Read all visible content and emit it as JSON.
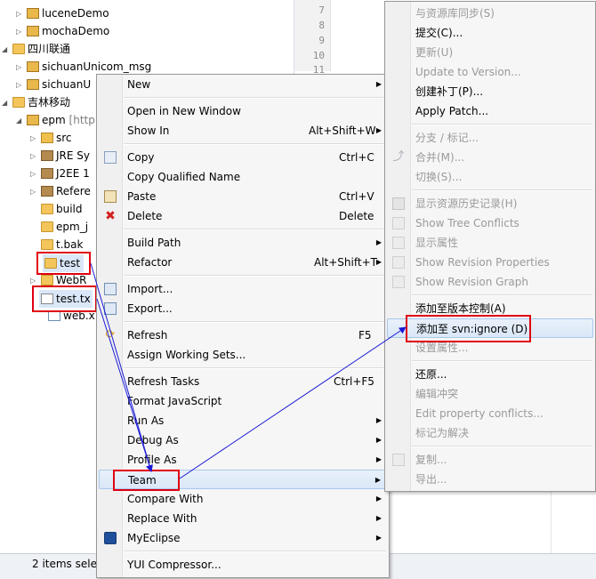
{
  "tree": {
    "rows": [
      {
        "label": "luceneDemo",
        "suffix": ""
      },
      {
        "label": "mochaDemo",
        "suffix": ""
      },
      {
        "label": "四川联通",
        "suffix": ""
      },
      {
        "label": "sichuanUnicom_msg",
        "suffix": ""
      },
      {
        "label": "sichuanU",
        "suffix": ""
      },
      {
        "label": "吉林移动",
        "suffix": ""
      },
      {
        "label": "epm",
        "suffix": "[http"
      },
      {
        "label": "src",
        "suffix": ""
      },
      {
        "label": "JRE Sy",
        "suffix": ""
      },
      {
        "label": "J2EE 1",
        "suffix": ""
      },
      {
        "label": "Refere",
        "suffix": ""
      },
      {
        "label": "build",
        "suffix": ""
      },
      {
        "label": "epm_j",
        "suffix": ""
      },
      {
        "label": "t.bak",
        "suffix": ""
      },
      {
        "label": "test",
        "suffix": ""
      },
      {
        "label": "WebR",
        "suffix": ""
      },
      {
        "label": "test.tx",
        "suffix": ""
      },
      {
        "label": "web.x",
        "suffix": ""
      }
    ]
  },
  "editor": {
    "line_numbers": [
      "7",
      "8",
      "9",
      "10",
      "11"
    ]
  },
  "status": {
    "text": "2 items sele"
  },
  "context_menu": {
    "items": [
      {
        "label": "New",
        "shortcut": "",
        "submenu": true
      },
      {
        "label": "Open in New Window",
        "shortcut": "",
        "submenu": false
      },
      {
        "label": "Show In",
        "shortcut": "Alt+Shift+W",
        "submenu": true
      },
      {
        "label": "Copy",
        "shortcut": "Ctrl+C",
        "submenu": false
      },
      {
        "label": "Copy Qualified Name",
        "shortcut": "",
        "submenu": false
      },
      {
        "label": "Paste",
        "shortcut": "Ctrl+V",
        "submenu": false
      },
      {
        "label": "Delete",
        "shortcut": "Delete",
        "submenu": false
      },
      {
        "label": "Build Path",
        "shortcut": "",
        "submenu": true
      },
      {
        "label": "Refactor",
        "shortcut": "Alt+Shift+T",
        "submenu": true
      },
      {
        "label": "Import...",
        "shortcut": "",
        "submenu": false
      },
      {
        "label": "Export...",
        "shortcut": "",
        "submenu": false
      },
      {
        "label": "Refresh",
        "shortcut": "F5",
        "submenu": false
      },
      {
        "label": "Assign Working Sets...",
        "shortcut": "",
        "submenu": false
      },
      {
        "label": "Refresh Tasks",
        "shortcut": "Ctrl+F5",
        "submenu": false
      },
      {
        "label": "Format JavaScript",
        "shortcut": "",
        "submenu": false
      },
      {
        "label": "Run As",
        "shortcut": "",
        "submenu": true
      },
      {
        "label": "Debug As",
        "shortcut": "",
        "submenu": true
      },
      {
        "label": "Profile As",
        "shortcut": "",
        "submenu": true
      },
      {
        "label": "Team",
        "shortcut": "",
        "submenu": true
      },
      {
        "label": "Compare With",
        "shortcut": "",
        "submenu": true
      },
      {
        "label": "Replace With",
        "shortcut": "",
        "submenu": true
      },
      {
        "label": "MyEclipse",
        "shortcut": "",
        "submenu": true
      },
      {
        "label": "YUI Compressor...",
        "shortcut": "",
        "submenu": false
      }
    ]
  },
  "team_menu": {
    "items": [
      {
        "label": "与资源库同步(S)",
        "enabled": false
      },
      {
        "label": "提交(C)...",
        "enabled": true
      },
      {
        "label": "更新(U)",
        "enabled": false
      },
      {
        "label": "Update to Version...",
        "enabled": false
      },
      {
        "label": "创建补丁(P)...",
        "enabled": true
      },
      {
        "label": "Apply Patch...",
        "enabled": true
      },
      {
        "label": "分支 / 标记...",
        "enabled": false
      },
      {
        "label": "合并(M)...",
        "enabled": false
      },
      {
        "label": "切换(S)...",
        "enabled": false
      },
      {
        "label": "显示资源历史记录(H)",
        "enabled": false
      },
      {
        "label": "Show Tree Conflicts",
        "enabled": false
      },
      {
        "label": "显示属性",
        "enabled": false
      },
      {
        "label": "Show Revision Properties",
        "enabled": false
      },
      {
        "label": "Show Revision Graph",
        "enabled": false
      },
      {
        "label": "添加至版本控制(A)",
        "enabled": true
      },
      {
        "label": "添加至 svn:ignore (D)",
        "enabled": true
      },
      {
        "label": "设置属性...",
        "enabled": false
      },
      {
        "label": "还原...",
        "enabled": true
      },
      {
        "label": "编辑冲突",
        "enabled": false
      },
      {
        "label": "Edit property conflicts...",
        "enabled": false
      },
      {
        "label": "标记为解决",
        "enabled": false
      },
      {
        "label": "复制...",
        "enabled": false
      },
      {
        "label": "导出...",
        "enabled": false
      }
    ]
  },
  "colors": {
    "highlight_box": "#e00010",
    "arrow": "#1a1ad6"
  }
}
